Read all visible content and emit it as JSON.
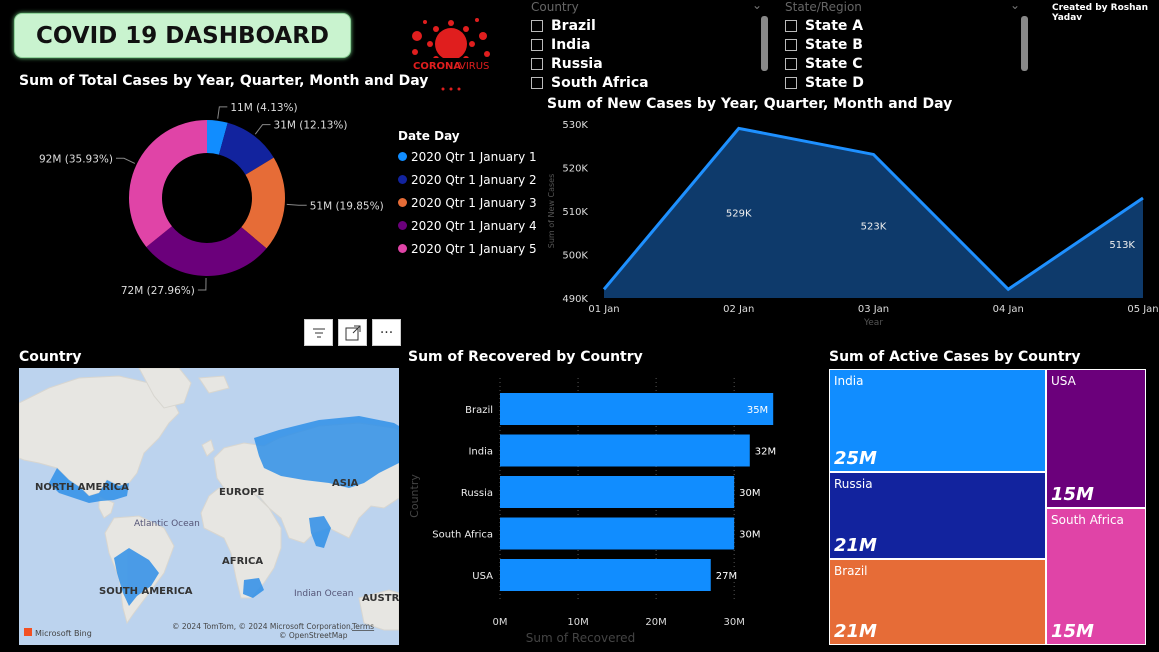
{
  "header": {
    "title": "COVID 19 DASHBOARD",
    "credit": "Created by Roshan Yadav"
  },
  "logo": {
    "text_corona": "CORONA",
    "text_virus": "VIRUS"
  },
  "country_slicer": {
    "heading": "Country",
    "items": [
      "Brazil",
      "India",
      "Russia",
      "South Africa"
    ]
  },
  "state_slicer": {
    "heading": "State/Region",
    "items": [
      "State A",
      "State B",
      "State C",
      "State D"
    ]
  },
  "donut": {
    "title": "Sum of Total Cases by Year, Quarter, Month and Day",
    "legend_title": "Date Day",
    "legend": [
      "2020 Qtr 1 January 1",
      "2020 Qtr 1 January 2",
      "2020 Qtr 1 January 3",
      "2020 Qtr 1 January 4",
      "2020 Qtr 1 January 5"
    ],
    "labels": [
      "11M (4.13%)",
      "31M (12.13%)",
      "51M (19.85%)",
      "72M (27.96%)",
      "92M (35.93%)"
    ]
  },
  "line": {
    "title": "Sum of New Cases by Year, Quarter, Month and Day",
    "ylabel": "Sum of New Cases",
    "xlabel": "Year",
    "yticks": [
      "530K",
      "520K",
      "510K",
      "500K",
      "490K"
    ],
    "xticks": [
      "01 Jan",
      "02 Jan",
      "03 Jan",
      "04 Jan",
      "05 Jan"
    ],
    "data_labels": [
      "529K",
      "523K",
      "513K"
    ]
  },
  "visual_header": {
    "filter_icon": "filter-icon",
    "focus_icon": "focus-mode-icon",
    "more_icon": "more-options-icon"
  },
  "map": {
    "title": "Country",
    "labels": {
      "na": "NORTH AMERICA",
      "europe": "EUROPE",
      "asia": "ASIA",
      "atlantic": "Atlantic Ocean",
      "africa": "AFRICA",
      "sa": "SOUTH AMERICA",
      "indian": "Indian Ocean",
      "austral": "AUSTRA"
    },
    "bing": "Microsoft Bing",
    "copyright": "© 2024 TomTom, © 2024 Microsoft Corporation,",
    "osm": "© OpenStreetMap",
    "terms": "Terms"
  },
  "bar": {
    "title": "Sum of Recovered by Country",
    "ylabel": "Country",
    "xlabel": "Sum of Recovered",
    "xticks": [
      "0M",
      "10M",
      "20M",
      "30M"
    ]
  },
  "treemap": {
    "title": "Sum of Active Cases by Country",
    "cells": [
      {
        "label": "India",
        "value": "25M",
        "color": "#118dff"
      },
      {
        "label": "USA",
        "value": "15M",
        "color": "#6b007b"
      },
      {
        "label": "Russia",
        "value": "21M",
        "color": "#12239e"
      },
      {
        "label": "South Africa",
        "value": "15M",
        "color": "#e044a7"
      },
      {
        "label": "Brazil",
        "value": "21M",
        "color": "#e66c37"
      }
    ]
  },
  "chart_data": [
    {
      "type": "pie",
      "title": "Sum of Total Cases by Year, Quarter, Month and Day",
      "categories": [
        "2020 Qtr 1 January 1",
        "2020 Qtr 1 January 2",
        "2020 Qtr 1 January 3",
        "2020 Qtr 1 January 4",
        "2020 Qtr 1 January 5"
      ],
      "values": [
        11,
        31,
        51,
        72,
        92
      ],
      "percentages": [
        4.13,
        12.13,
        19.85,
        27.96,
        35.93
      ],
      "colors": [
        "#118dff",
        "#12239e",
        "#e66c37",
        "#6b007b",
        "#e044a7"
      ],
      "legend_position": "right"
    },
    {
      "type": "area",
      "title": "Sum of New Cases by Year, Quarter, Month and Day",
      "xlabel": "Year",
      "ylabel": "Sum of New Cases",
      "x": [
        "01 Jan",
        "02 Jan",
        "03 Jan",
        "04 Jan",
        "05 Jan"
      ],
      "values": [
        492,
        529,
        523,
        492,
        513
      ],
      "ylim": [
        490,
        530
      ],
      "color": "#118dff"
    },
    {
      "type": "bar",
      "title": "Sum of Recovered by Country",
      "xlabel": "Sum of Recovered",
      "ylabel": "Country",
      "categories": [
        "Brazil",
        "India",
        "Russia",
        "South Africa",
        "USA"
      ],
      "values": [
        35,
        32,
        30,
        30,
        27
      ],
      "value_labels": [
        "35M",
        "32M",
        "30M",
        "30M",
        "27M"
      ],
      "xlim": [
        0,
        36
      ],
      "color": "#118dff"
    },
    {
      "type": "treemap",
      "title": "Sum of Active Cases by Country",
      "categories": [
        "India",
        "USA",
        "Russia",
        "South Africa",
        "Brazil"
      ],
      "values": [
        25,
        15,
        21,
        15,
        21
      ]
    }
  ]
}
